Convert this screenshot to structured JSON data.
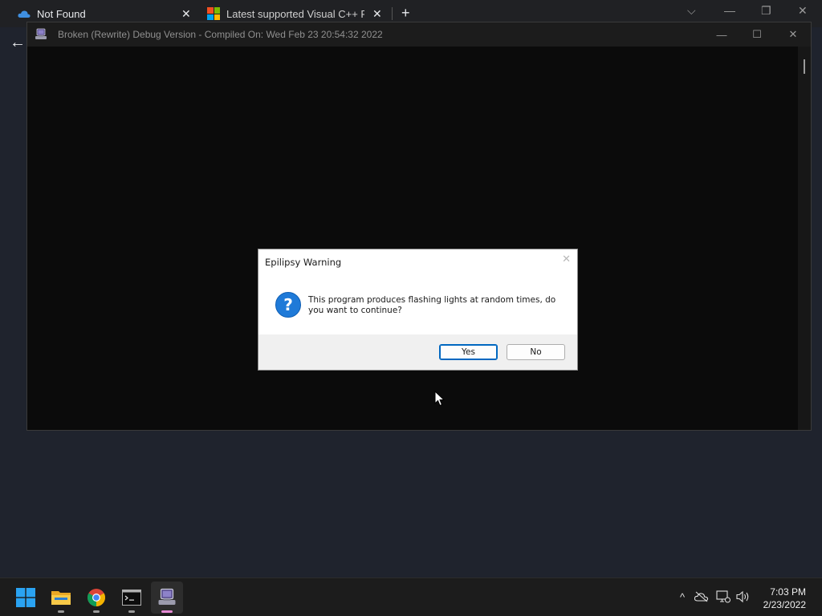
{
  "browser": {
    "tabs": [
      {
        "label": "Not Found",
        "icon": "cloud-icon",
        "close": "✕"
      },
      {
        "label": "Latest supported Visual C++ Red",
        "icon": "microsoft-logo-icon",
        "close": "✕"
      }
    ],
    "new_tab": "+",
    "tab_list": "⌵",
    "minimize": "—",
    "restore": "❐",
    "close": "✕",
    "back": "←"
  },
  "app_window": {
    "title": "Broken (Rewrite) Debug Version - Compiled On: Wed Feb 23 20:54:32 2022",
    "icon": "computer-app-icon",
    "minimize": "—",
    "maximize": "☐",
    "close": "✕"
  },
  "dialog": {
    "title": "Epilipsy Warning",
    "close": "✕",
    "icon": "question-icon",
    "icon_glyph": "?",
    "message": "This program produces flashing lights at random times, do you want to continue?",
    "buttons": {
      "yes": "Yes",
      "no": "No"
    }
  },
  "taskbar": {
    "items": [
      {
        "name": "start",
        "icon": "windows-start-icon"
      },
      {
        "name": "file-explorer",
        "icon": "folder-icon"
      },
      {
        "name": "chrome",
        "icon": "chrome-icon"
      },
      {
        "name": "terminal",
        "icon": "terminal-icon"
      },
      {
        "name": "broken-app",
        "icon": "computer-app-icon",
        "active": true
      }
    ],
    "tray": {
      "chevron": "^",
      "time": "7:03 PM",
      "date": "2/23/2022"
    }
  },
  "colors": {
    "accent": "#0067c0",
    "dialog_question": "#1f7ad8",
    "active_indicator": "#e58ad4",
    "desktop_bg": "#1f232d"
  }
}
